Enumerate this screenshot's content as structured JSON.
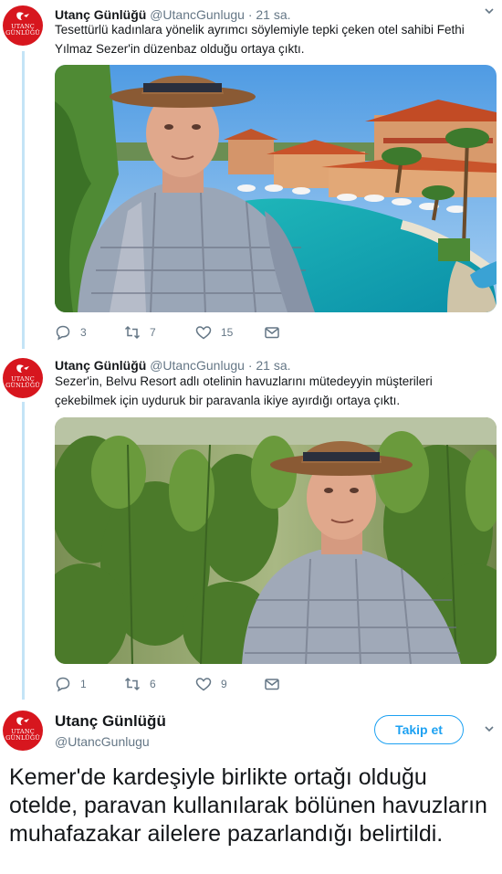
{
  "account": {
    "name": "Utanç Günlüğü",
    "handle": "@UtancGunlugu",
    "logo_text": [
      "UTANÇ",
      "GÜNLÜĞÜ"
    ]
  },
  "tweets": [
    {
      "time": "21 sa.",
      "text": "Tesettürlü kadınlara yönelik ayrımcı söylemiyle tepki çeken otel sahibi Fethi Yılmaz Sezer'in düzenbaz olduğu ortaya çıktı.",
      "replies": "3",
      "retweets": "7",
      "likes": "15"
    },
    {
      "time": "21 sa.",
      "text": "Sezer'in, Belvu Resort adlı otelinin havuzlarını mütedeyyin müşterileri çekebilmek için uyduruk bir paravanla ikiye ayırdığı ortaya çıktı.",
      "replies": "1",
      "retweets": "6",
      "likes": "9"
    }
  ],
  "follow_button": "Takip et",
  "caption": "Kemer'de kardeşiyle birlikte ortağı olduğu otelde, paravan kullanılarak bölünen havuzların muhafazakar ailelere pazarlandığı belirtildi.",
  "colors": {
    "brand_red": "#d7161e",
    "twitter_blue": "#1da1f2",
    "muted": "#657786",
    "thread": "#c4e4f6"
  },
  "icons": [
    "reply-icon",
    "retweet-icon",
    "like-icon",
    "dm-icon",
    "chevron-down-icon"
  ]
}
